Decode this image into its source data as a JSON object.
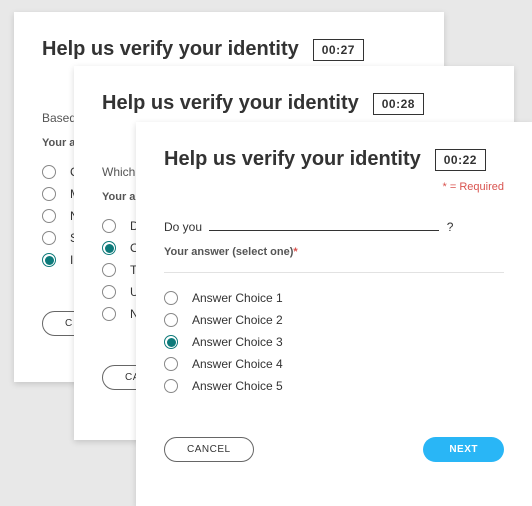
{
  "shared": {
    "title": "Help us verify your identity",
    "required_note_prefix": "*",
    "required_note_text": " = Required",
    "select_label": "Your answer (select one)",
    "cancel": "CANCEL",
    "next": "NEXT"
  },
  "card1": {
    "timer": "00:27",
    "intro_line": "Based",
    "select_prefix": "Your an",
    "options": [
      {
        "label": "C",
        "selected": false
      },
      {
        "label": "M",
        "selected": false
      },
      {
        "label": "N",
        "selected": false
      },
      {
        "label": "S",
        "selected": false
      },
      {
        "label": "I",
        "selected": true
      }
    ]
  },
  "card2": {
    "timer": "00:28",
    "intro_line": "Which of",
    "select_prefix": "Your ans",
    "options": [
      {
        "label": "Dai",
        "selected": false
      },
      {
        "label": "Ob",
        "selected": true
      },
      {
        "label": "Tui",
        "selected": false
      },
      {
        "label": "Uni",
        "selected": false
      },
      {
        "label": "Noi",
        "selected": false
      }
    ]
  },
  "card3": {
    "timer": "00:22",
    "question_prefix": "Do you",
    "question_suffix": "?",
    "options": [
      {
        "label": "Answer Choice 1",
        "selected": false
      },
      {
        "label": "Answer Choice 2",
        "selected": false
      },
      {
        "label": "Answer Choice 3",
        "selected": true
      },
      {
        "label": "Answer Choice 4",
        "selected": false
      },
      {
        "label": "Answer Choice 5",
        "selected": false
      }
    ]
  }
}
